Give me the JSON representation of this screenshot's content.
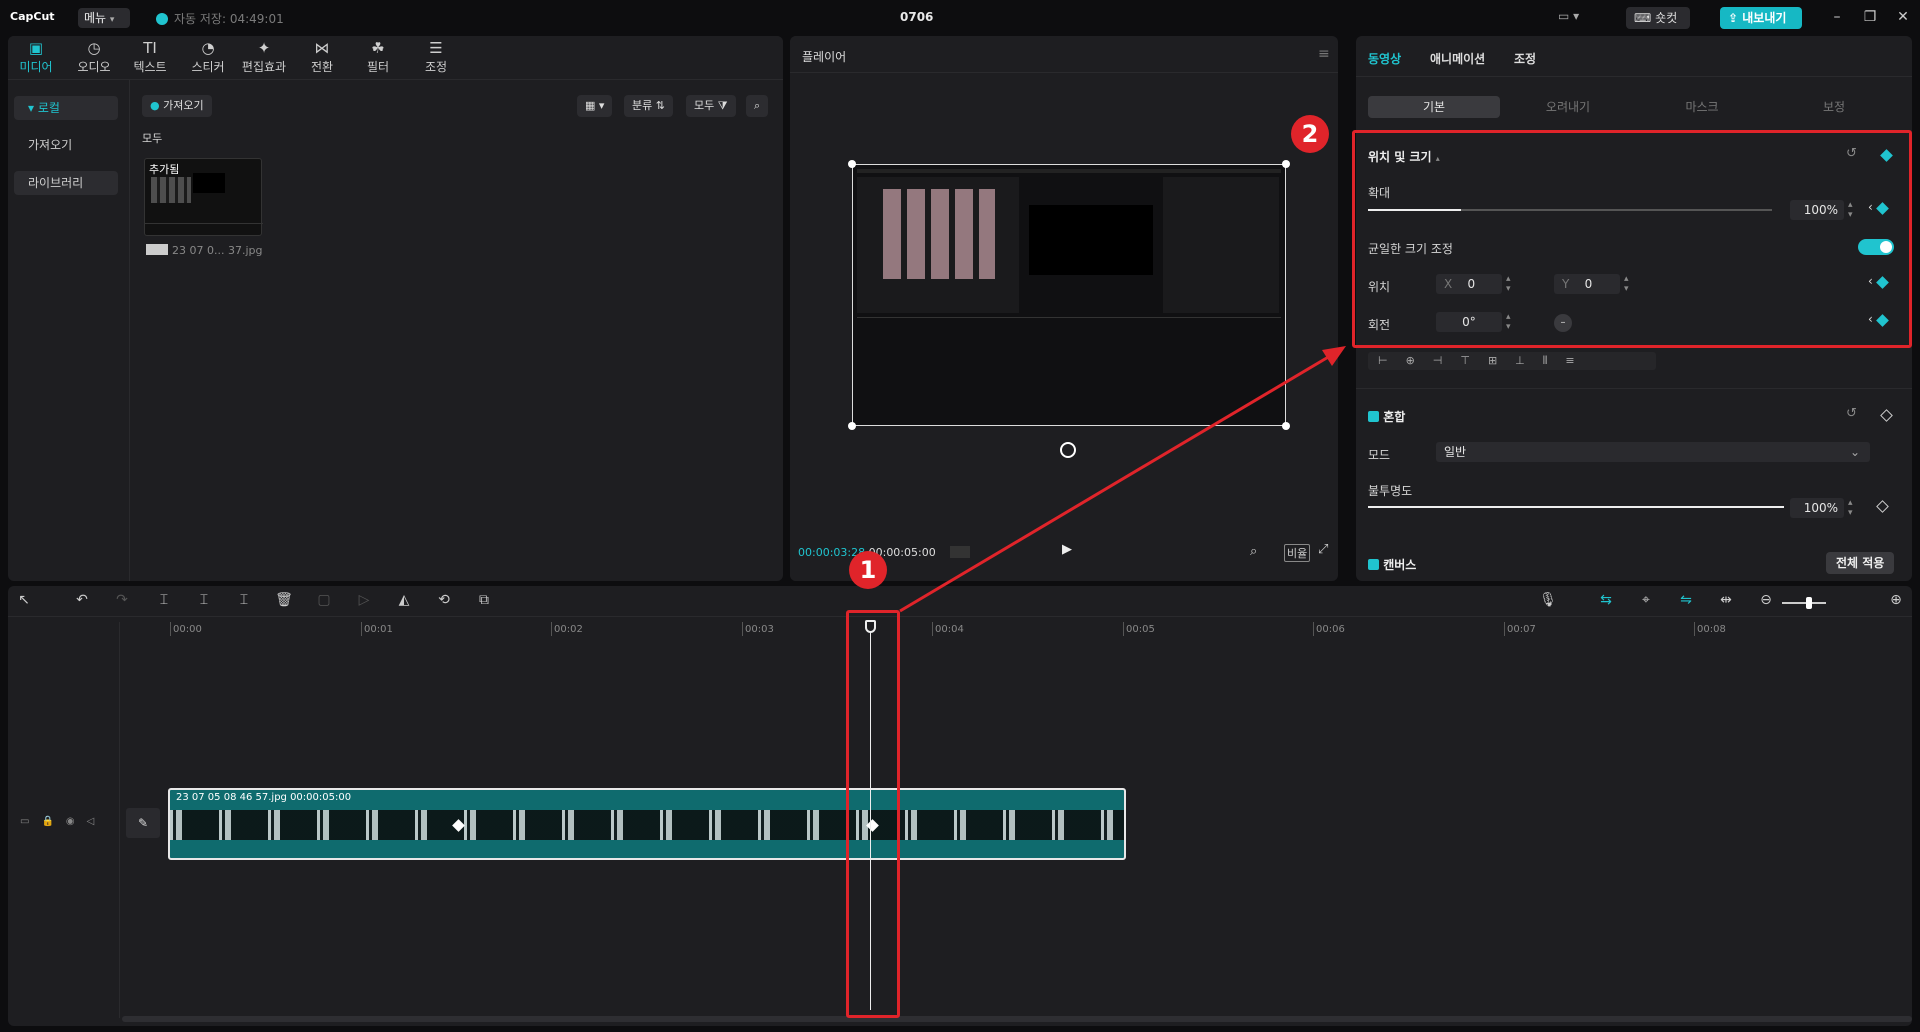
{
  "app": {
    "logo": "CapCut",
    "menu": "메뉴",
    "autosave": "자동 저장: 04:49:01",
    "title": "0706",
    "shortcut": "숏컷",
    "export": "내보내기"
  },
  "media": {
    "tabs": [
      {
        "label": "미디어",
        "icon": "media-icon"
      },
      {
        "label": "오디오",
        "icon": "audio-icon"
      },
      {
        "label": "텍스트",
        "icon": "text-icon"
      },
      {
        "label": "스티커",
        "icon": "sticker-icon"
      },
      {
        "label": "편집효과",
        "icon": "effects-icon"
      },
      {
        "label": "전환",
        "icon": "transition-icon"
      },
      {
        "label": "필터",
        "icon": "filter-icon"
      },
      {
        "label": "조정",
        "icon": "adjust-icon"
      }
    ],
    "sidebar": [
      "로컬",
      "가져오기",
      "라이브러리"
    ],
    "import_label": "가져오기",
    "sort_label": "분류",
    "filter_label": "모두",
    "section": "모두",
    "thumb_badge": "추가됨",
    "thumb_name": "23 07 0... 37.jpg"
  },
  "player": {
    "title": "플레이어",
    "current_time": "00:00:03:28",
    "total_time": "00:00:05:00",
    "ratio": "비율"
  },
  "inspector": {
    "tabs": [
      "동영상",
      "애니메이션",
      "조정"
    ],
    "subtabs": [
      "기본",
      "오려내기",
      "마스크",
      "보정"
    ],
    "position_size": "위치 및 크기",
    "scale_label": "확대",
    "scale_value": "100%",
    "scale_fraction": 0.23,
    "uniform_label": "균일한 크기 조정",
    "position_label": "위치",
    "x_label": "X",
    "x_value": "0",
    "y_label": "Y",
    "y_value": "0",
    "rotation_label": "회전",
    "rotation_value": "0°",
    "blend_label": "혼합",
    "mode_label": "모드",
    "mode_value": "일반",
    "opacity_label": "불투명도",
    "opacity_value": "100%",
    "opacity_fraction": 1.0,
    "canvas_label": "캔버스",
    "apply_all": "전체 적용"
  },
  "timeline": {
    "ticks": [
      "00:00",
      "00:01",
      "00:02",
      "00:03",
      "00:04",
      "00:05",
      "00:06",
      "00:07",
      "00:08"
    ],
    "clip_label": "23 07 05 08 46 57.jpg   00:00:05:00"
  },
  "annotations": [
    "1",
    "2"
  ],
  "colors": {
    "accent": "#20c4cf",
    "annotation": "#e0242a",
    "clip": "#0f6b6e"
  }
}
